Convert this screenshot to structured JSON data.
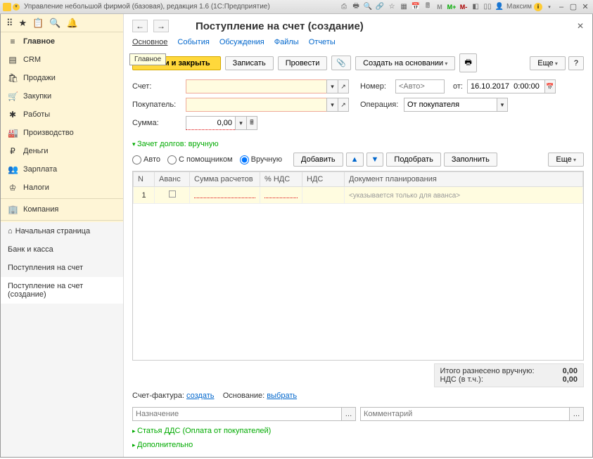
{
  "titlebar": {
    "title": "Управление небольшой фирмой (базовая), редакция 1.6  (1С:Предприятие)",
    "user": "Максим"
  },
  "sidebar": {
    "items": [
      {
        "icon": "≡",
        "label": "Главное",
        "active": true
      },
      {
        "icon": "▤",
        "label": "CRM"
      },
      {
        "icon": "🛍",
        "label": "Продажи"
      },
      {
        "icon": "🛒",
        "label": "Закупки"
      },
      {
        "icon": "✱",
        "label": "Работы"
      },
      {
        "icon": "🏭",
        "label": "Производство"
      },
      {
        "icon": "₽",
        "label": "Деньги"
      },
      {
        "icon": "👥",
        "label": "Зарплата"
      },
      {
        "icon": "♔",
        "label": "Налоги"
      },
      {
        "icon": "🏢",
        "label": "Компания"
      }
    ]
  },
  "subnav": {
    "items": [
      {
        "label": "Начальная страница",
        "home": true
      },
      {
        "label": "Банк и касса"
      },
      {
        "label": "Поступления на счет"
      },
      {
        "label": "Поступление на счет (создание)",
        "selected": true
      }
    ]
  },
  "doc": {
    "title": "Поступление на счет (создание)",
    "tabs": [
      "Основное",
      "События",
      "Обсуждения",
      "Файлы",
      "Отчеты"
    ],
    "active_tab": "Основное",
    "tooltip": "Главное",
    "buttons": {
      "primary": "овести и закрыть",
      "save": "Записать",
      "post": "Провести",
      "create_based": "Создать на основании",
      "more": "Еще",
      "help": "?"
    },
    "fields": {
      "account_lbl": "Счет:",
      "buyer_lbl": "Покупатель:",
      "amount_lbl": "Сумма:",
      "amount_val": "0,00",
      "number_lbl": "Номер:",
      "number_ph": "<Авто>",
      "date_lbl": "от:",
      "date_val": "16.10.2017  0:00:00",
      "operation_lbl": "Операция:",
      "operation_val": "От покупателя"
    },
    "section1_title": "Зачет долгов: вручную",
    "radios": {
      "auto": "Авто",
      "wizard": "С помощником",
      "manual": "Вручную"
    },
    "row_buttons": {
      "add": "Добавить",
      "pick": "Подобрать",
      "fill": "Заполнить",
      "more": "Еще"
    },
    "table": {
      "cols": [
        "N",
        "Аванс",
        "Сумма расчетов",
        "% НДС",
        "НДС",
        "Документ планирования"
      ],
      "rows": [
        {
          "n": "1",
          "doc_hint": "<указывается только для аванса>"
        }
      ]
    },
    "totals": {
      "manual_lbl": "Итого разнесено вручную:",
      "manual_val": "0,00",
      "vat_lbl": "НДС (в т.ч.):",
      "vat_val": "0,00"
    },
    "invoice": {
      "sf_lbl": "Счет-фактура:",
      "sf_link": "создать",
      "base_lbl": "Основание:",
      "base_link": "выбрать"
    },
    "bottom": {
      "purpose_ph": "Назначение",
      "comment_ph": "Комментарий"
    },
    "section2": "Статья ДДС (Оплата от покупателей)",
    "section3": "Дополнительно"
  }
}
